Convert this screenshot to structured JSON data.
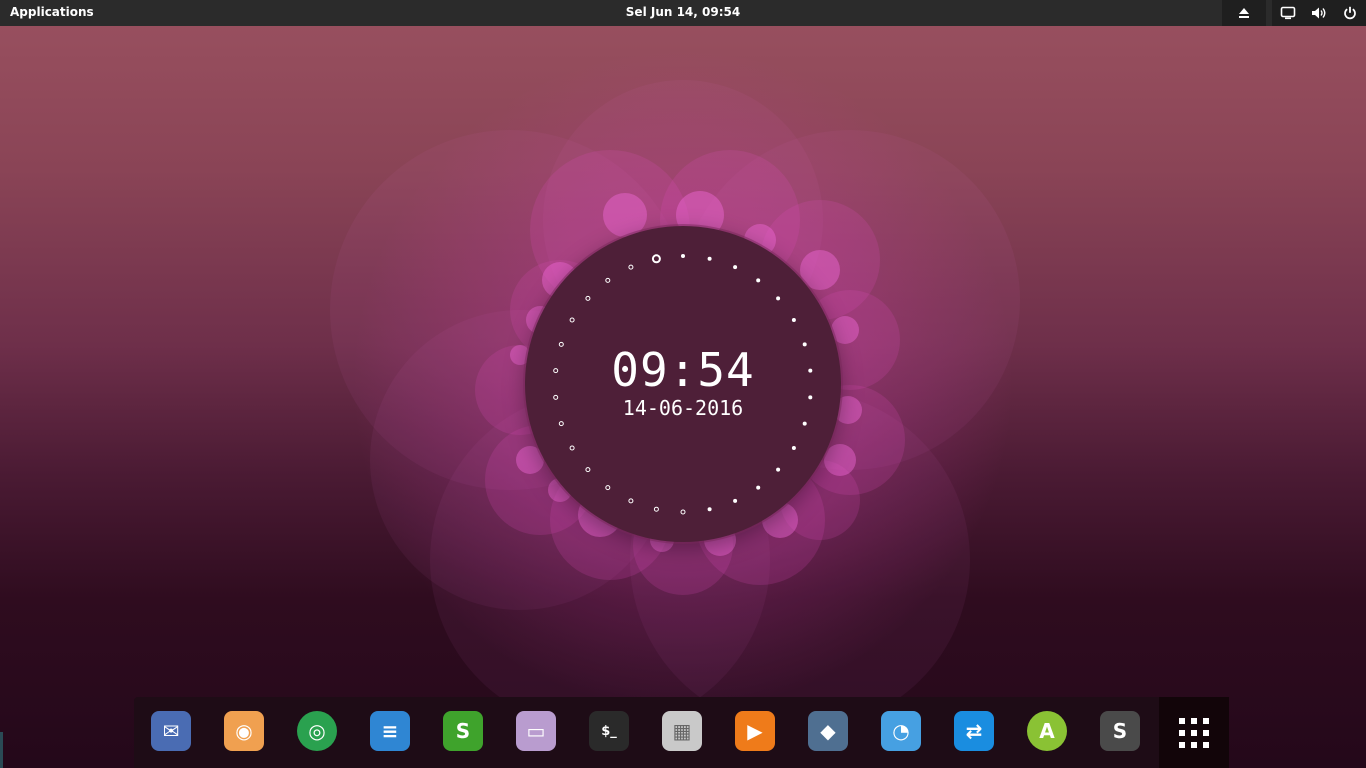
{
  "top_panel": {
    "applications_label": "Applications",
    "datetime": "Sel Jun 14, 09:54",
    "tray_icons": [
      "eject-icon",
      "display-icon",
      "volume-icon",
      "power-icon"
    ]
  },
  "clock_widget": {
    "time": "09:54",
    "date": "14-06-2016",
    "seconds_marks": 30,
    "highlight_mark": 29
  },
  "dock": {
    "items": [
      {
        "name": "mail-app-icon",
        "color": "#4a6cb3"
      },
      {
        "name": "firefox-icon",
        "color": "#f0a050"
      },
      {
        "name": "chrome-icon",
        "color": "#2aa14f"
      },
      {
        "name": "writer-icon",
        "color": "#2f86d3"
      },
      {
        "name": "spreadsheet-icon",
        "color": "#3fa32c"
      },
      {
        "name": "files-icon",
        "color": "#b99ccf"
      },
      {
        "name": "terminal-icon",
        "color": "#2a2a2a"
      },
      {
        "name": "radio-icon",
        "color": "#c9c9c9"
      },
      {
        "name": "media-player-icon",
        "color": "#ef7b1a"
      },
      {
        "name": "postgres-icon",
        "color": "#4f6f91"
      },
      {
        "name": "cast-icon",
        "color": "#46a0e2"
      },
      {
        "name": "teamviewer-icon",
        "color": "#1a8de0"
      },
      {
        "name": "android-studio-icon",
        "color": "#8ac234"
      },
      {
        "name": "sublime-text-icon",
        "color": "#4a4a4a"
      }
    ],
    "app_grid_icon": "app-grid-icon"
  }
}
